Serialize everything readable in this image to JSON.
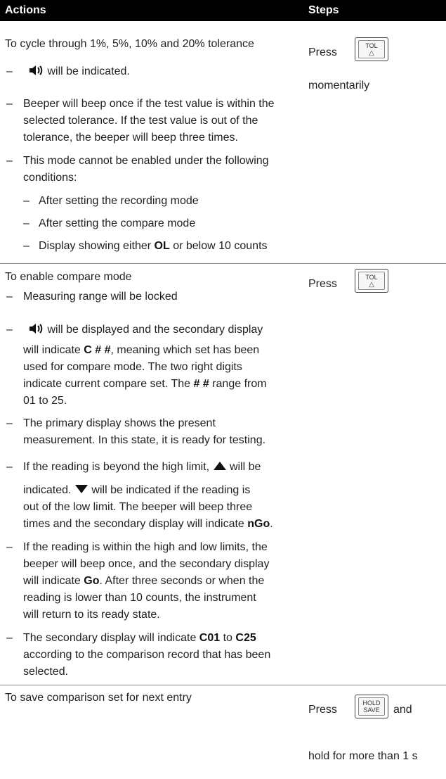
{
  "header": {
    "actions": "Actions",
    "steps": "Steps"
  },
  "icons": {
    "beeper": "speaker-icon",
    "up": "up-triangle-icon",
    "down": "down-triangle-icon"
  },
  "rows": [
    {
      "action": "To cycle through 1%, 5%, 10% and 20% tolerance",
      "bullets": {
        "b1": "will be indicated.",
        "b2_l1": "Beeper will beep once if the test value is within the",
        "b2_l2": "selected tolerance. If the test value is out of the",
        "b2_l3": "tolerance, the beeper will beep three times.",
        "b3_l1": "This mode cannot be enabled under the following",
        "b3_l2": "conditions:",
        "s1": "After setting the recording mode",
        "s2": "After setting the compare mode",
        "s3a": "Display showing either",
        "s3b": "OL",
        "s3c": "or below 10 counts"
      },
      "step": {
        "press": "Press",
        "key_top": "TOL",
        "key_bottom": "△",
        "after": "momentarily"
      }
    },
    {
      "action": "To enable compare mode",
      "bullets": {
        "b1": "Measuring range will be locked",
        "b2_l1": "will be displayed and the secondary display",
        "b2_l2a": "will indicate",
        "b2_l2b": "C # #",
        "b2_l2c": ", meaning which set has been",
        "b2_l3": "used for compare mode. The two right digits",
        "b2_l4a": "indicate current compare set. The",
        "b2_l4b": "# #",
        "b2_l4c": "range from",
        "b2_l5": "01 to 25.",
        "b3_l1": "The primary display shows the present",
        "b3_l2": "measurement. In this state, it is ready for testing.",
        "b4_l1a": "If the reading is beyond the high limit,",
        "b4_l1b": "will be",
        "b4_l2a": "indicated.",
        "b4_l2b": "will be indicated if the reading is",
        "b4_l3": "out of the low limit. The beeper will beep three",
        "b4_l4a": "times and the secondary display will indicate",
        "b4_l4b": "nGo",
        "b4_l4c": ".",
        "b5_l1": "If the reading is within the high and low limits, the",
        "b5_l2": "beeper will beep once, and the secondary display",
        "b5_l3a": "will indicate",
        "b5_l3b": "Go",
        "b5_l3c": ". After three seconds or when the",
        "b5_l4": "reading is lower than 10 counts, the instrument",
        "b5_l5": "will return to its ready state.",
        "b6_l1a": "The secondary display will indicate",
        "b6_l1b": "C01",
        "b6_l1c": "to",
        "b6_l1d": "C25",
        "b6_l2": "according to the comparison record that has been",
        "b6_l3": "selected."
      },
      "step": {
        "press": "Press",
        "key_top": "TOL",
        "key_bottom": "△"
      }
    },
    {
      "action": "To save comparison set for next entry",
      "step": {
        "press": "Press",
        "key_top": "HOLD",
        "key_bottom": "SAVE",
        "and": "and",
        "after": "hold for more than 1 s"
      }
    }
  ]
}
